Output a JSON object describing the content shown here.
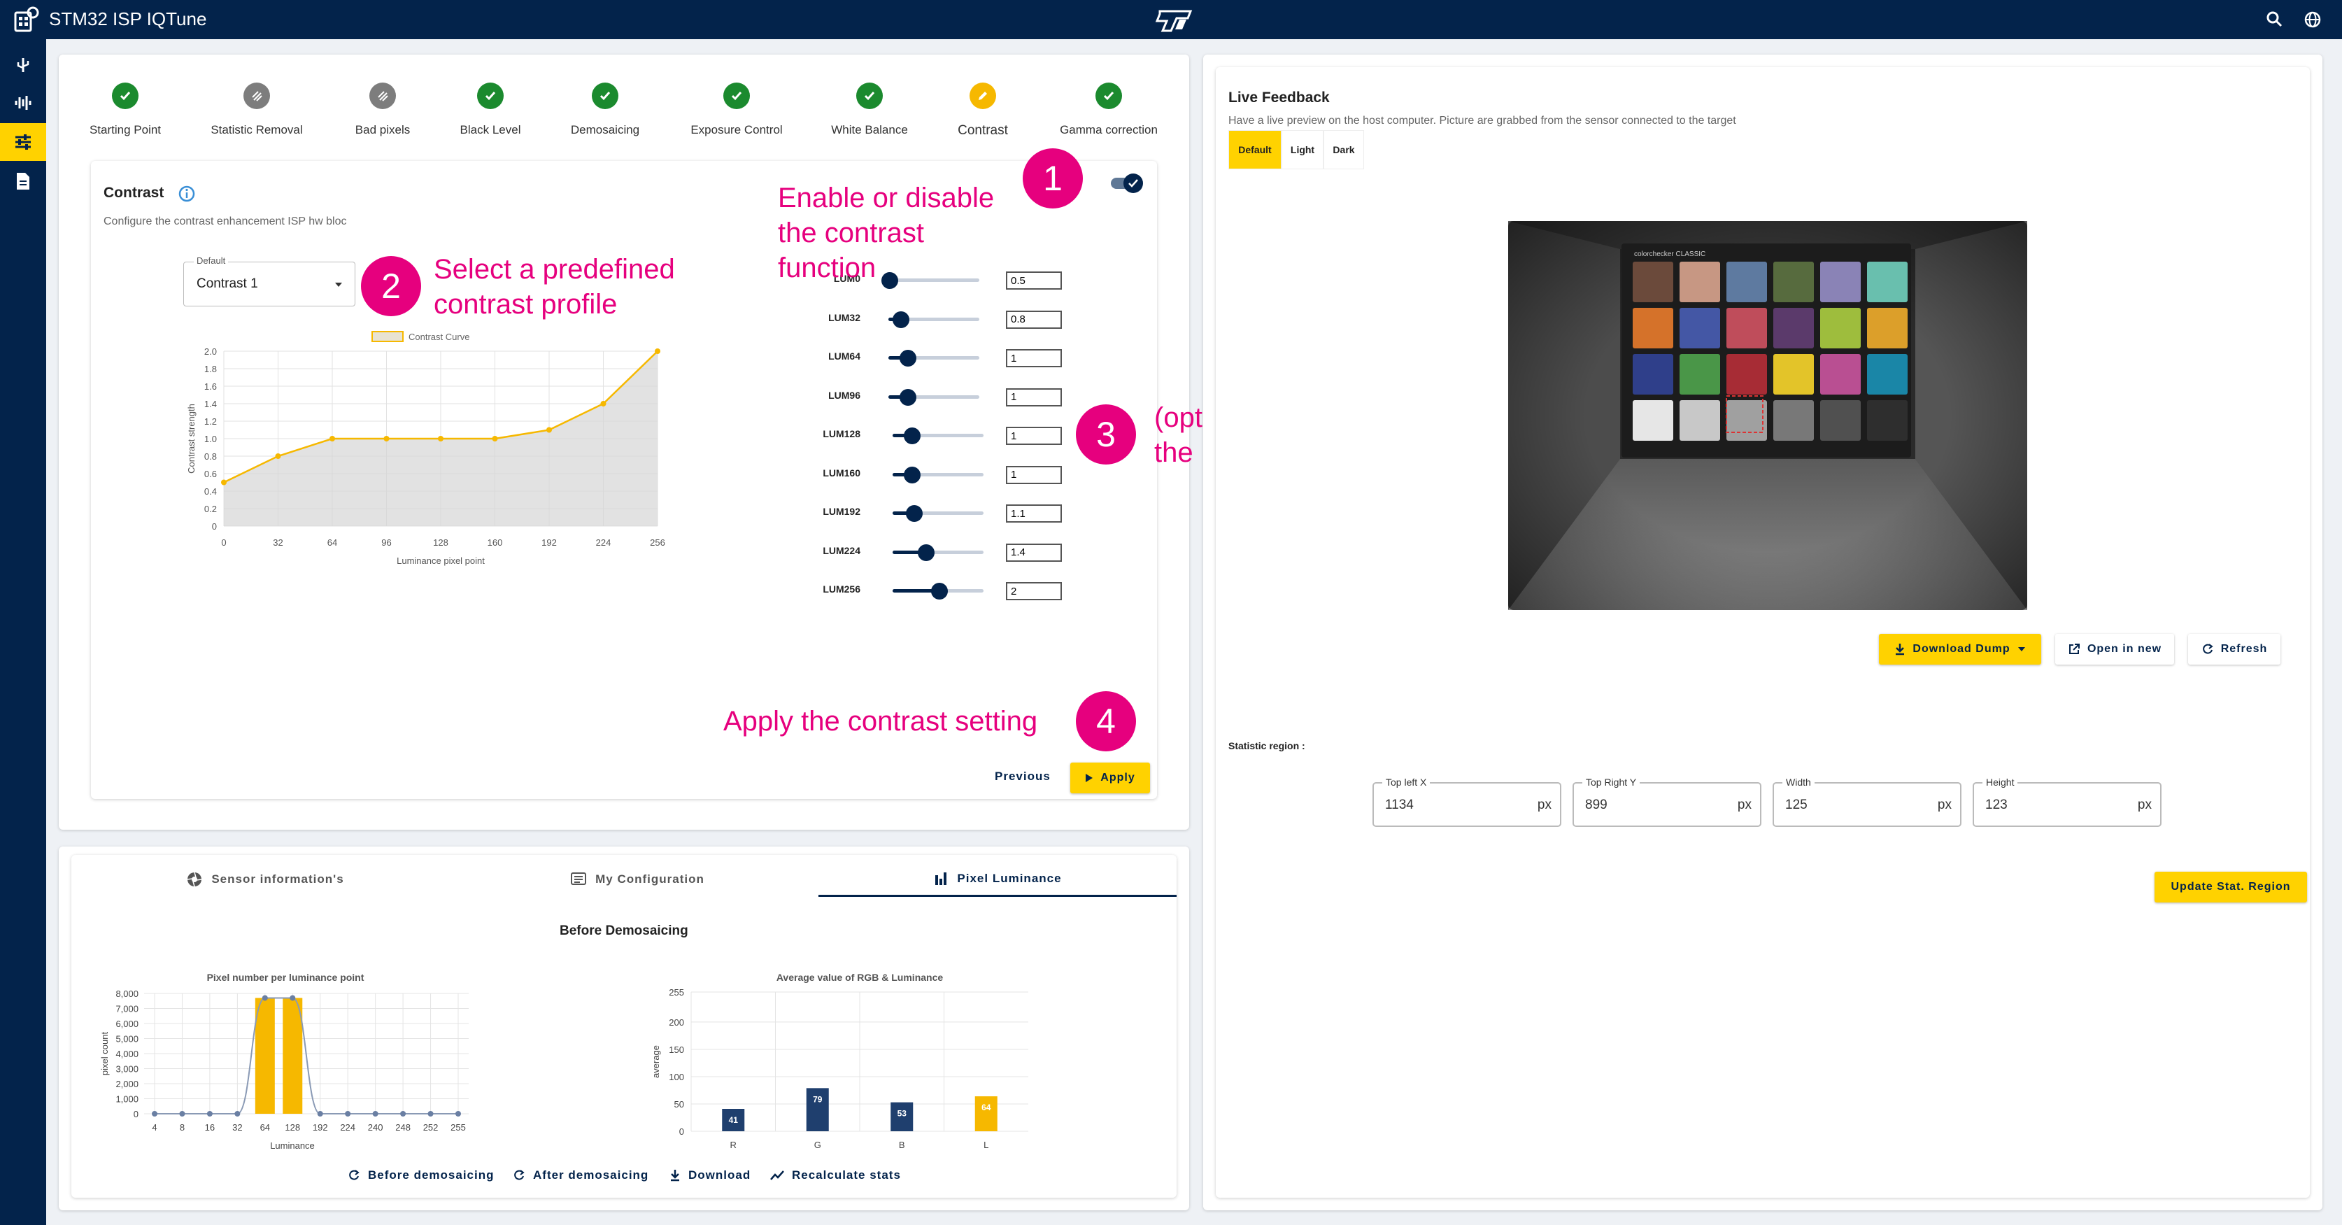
{
  "app": {
    "title": "STM32 ISP IQTune"
  },
  "stepper": [
    {
      "label": "Starting Point",
      "status": "done"
    },
    {
      "label": "Statistic Removal",
      "status": "skipped"
    },
    {
      "label": "Bad pixels",
      "status": "skipped"
    },
    {
      "label": "Black Level",
      "status": "done"
    },
    {
      "label": "Demosaicing",
      "status": "done"
    },
    {
      "label": "Exposure Control",
      "status": "done"
    },
    {
      "label": "White Balance",
      "status": "done"
    },
    {
      "label": "Contrast",
      "status": "current"
    },
    {
      "label": "Gamma correction",
      "status": "done"
    }
  ],
  "contrast": {
    "title": "Contrast",
    "subtitle": "Configure the contrast enhancement ISP hw bloc",
    "enabled": true,
    "profile_legend": "Default",
    "profile_value": "Contrast 1",
    "lut": [
      {
        "label": "LUM0",
        "value": "0.5"
      },
      {
        "label": "LUM32",
        "value": "0.8"
      },
      {
        "label": "LUM64",
        "value": "1"
      },
      {
        "label": "LUM96",
        "value": "1"
      },
      {
        "label": "LUM128",
        "value": "1"
      },
      {
        "label": "LUM160",
        "value": "1"
      },
      {
        "label": "LUM192",
        "value": "1.1"
      },
      {
        "label": "LUM224",
        "value": "1.4"
      },
      {
        "label": "LUM256",
        "value": "2"
      }
    ],
    "previous_label": "Previous",
    "apply_label": "Apply"
  },
  "annotations": [
    {
      "num": "1",
      "text": "Enable or disable the contrast function"
    },
    {
      "num": "2",
      "text": "Select a predefined contrast profile"
    },
    {
      "num": "3",
      "text": "(optional) Manually tune the LUT"
    },
    {
      "num": "4",
      "text": "Apply the contrast setting"
    }
  ],
  "chart_data": [
    {
      "type": "area",
      "legend": "Contrast Curve",
      "xlabel": "Luminance pixel point",
      "ylabel": "Contrast strength",
      "x": [
        0,
        32,
        64,
        96,
        128,
        160,
        192,
        224,
        256
      ],
      "values": [
        0.5,
        0.8,
        1.0,
        1.0,
        1.0,
        1.0,
        1.1,
        1.4,
        2.0
      ],
      "ylim": [
        0,
        2.0
      ],
      "yticks": [
        "0",
        "0.2",
        "0.4",
        "0.6",
        "0.8",
        "1.0",
        "1.2",
        "1.4",
        "1.6",
        "1.8",
        "2.0"
      ],
      "color": "#f6b800",
      "grid": true
    },
    {
      "type": "bar",
      "title": "Pixel number per luminance point",
      "xlabel": "Luminance",
      "ylabel": "pixel count",
      "categories": [
        "4",
        "8",
        "16",
        "32",
        "64",
        "128",
        "192",
        "224",
        "240",
        "248",
        "252",
        "255"
      ],
      "values": [
        0,
        0,
        0,
        0,
        7700,
        7700,
        0,
        0,
        0,
        0,
        0,
        0
      ],
      "ylim": [
        0,
        8000
      ],
      "yticks": [
        "0",
        "1,000",
        "2,000",
        "3,000",
        "4,000",
        "5,000",
        "6,000",
        "7,000",
        "8,000"
      ],
      "bar_color": "#f6b800",
      "grid": true
    },
    {
      "type": "bar",
      "title": "Average value of RGB & Luminance",
      "ylabel": "average",
      "categories": [
        "R",
        "G",
        "B",
        "L"
      ],
      "values": [
        41,
        79,
        53,
        64
      ],
      "value_labels": [
        "41",
        "79",
        "53",
        "64"
      ],
      "ylim": [
        0,
        255
      ],
      "yticks": [
        "0",
        "50",
        "100",
        "150",
        "200",
        "255"
      ],
      "colors": [
        "#1f3f6e",
        "#1f3f6e",
        "#1f3f6e",
        "#f6b800"
      ],
      "grid": true
    }
  ],
  "bottom": {
    "tabs": [
      {
        "label": "Sensor information's",
        "icon": "aperture-icon"
      },
      {
        "label": "My Configuration",
        "icon": "config-icon"
      },
      {
        "label": "Pixel Luminance",
        "icon": "bar-chart-icon"
      }
    ],
    "heading": "Before Demosaicing",
    "actions": [
      {
        "label": "Before demosaicing",
        "icon": "refresh-icon"
      },
      {
        "label": "After demosaicing",
        "icon": "refresh-icon"
      },
      {
        "label": "Download",
        "icon": "download-icon"
      },
      {
        "label": "Recalculate stats",
        "icon": "stats-icon"
      }
    ]
  },
  "live": {
    "title": "Live Feedback",
    "subtitle": "Have a live preview on the host computer. Picture are grabbed from the sensor connected to the target",
    "themes": [
      "Default",
      "Light",
      "Dark"
    ],
    "checker_brand": "colorchecker CLASSIC",
    "download_label": "Download Dump",
    "open_label": "Open in new",
    "refresh_label": "Refresh",
    "stat_label": "Statistic region :",
    "fields": [
      {
        "label": "Top left X",
        "value": "1134",
        "unit": "px"
      },
      {
        "label": "Top Right Y",
        "value": "899",
        "unit": "px"
      },
      {
        "label": "Width",
        "value": "125",
        "unit": "px"
      },
      {
        "label": "Height",
        "value": "123",
        "unit": "px"
      }
    ],
    "update_label": "Update Stat. Region"
  }
}
